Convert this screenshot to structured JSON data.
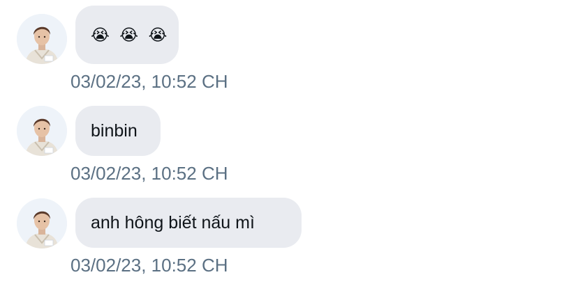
{
  "messages": [
    {
      "text": "😭 😭 😭",
      "timestamp": "03/02/23, 10:52 CH",
      "is_emoji": true
    },
    {
      "text": "binbin",
      "timestamp": "03/02/23, 10:52 CH",
      "is_emoji": false
    },
    {
      "text": "anh hông biết nấu mì",
      "timestamp": "03/02/23, 10:52 CH",
      "is_emoji": false
    }
  ],
  "colors": {
    "bubble_bg": "#e9ebf0",
    "text": "#0f1419",
    "timestamp": "#5b7083"
  },
  "icons": {
    "avatar": "user-avatar-photo"
  }
}
